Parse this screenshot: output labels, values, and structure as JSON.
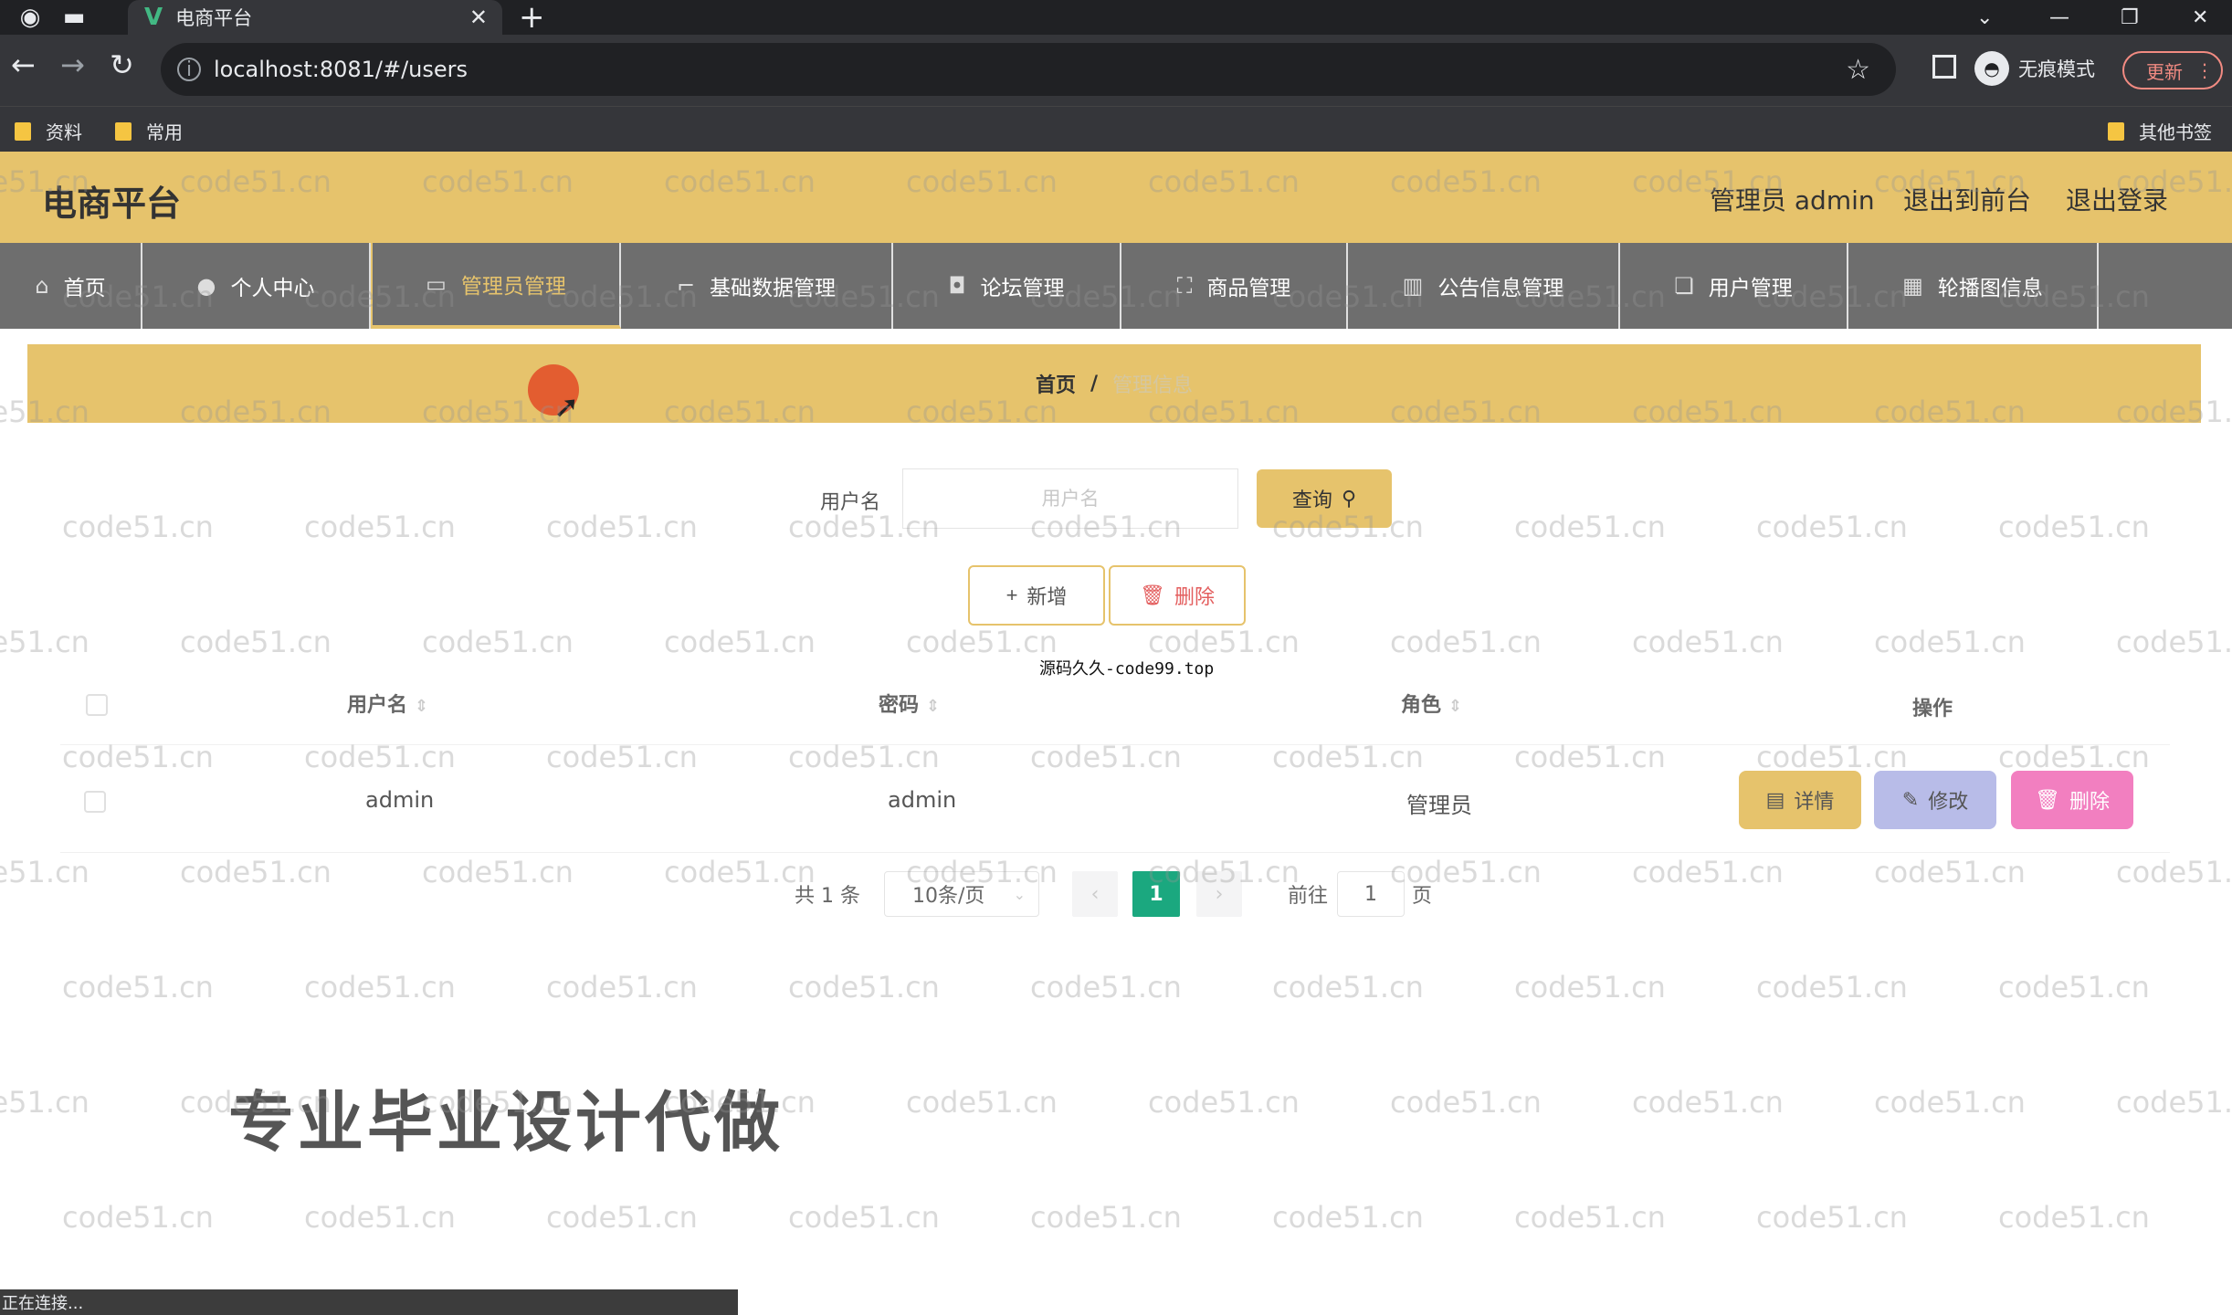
{
  "browser": {
    "tab_title": "电商平台",
    "url": "localhost:8081/#/users",
    "incognito_label": "无痕模式",
    "update_label": "更新",
    "bookmarks": [
      "资料",
      "常用"
    ],
    "other_bookmarks": "其他书签",
    "status_text": "正在连接..."
  },
  "header": {
    "brand": "电商平台",
    "user_label": "管理员 admin",
    "front_link": "退出到前台",
    "logout_link": "退出登录"
  },
  "nav": {
    "items": [
      {
        "label": "首页",
        "icon": "home-icon"
      },
      {
        "label": "个人中心",
        "icon": "user-icon"
      },
      {
        "label": "管理员管理",
        "icon": "card-icon"
      },
      {
        "label": "基础数据管理",
        "icon": "crop-icon"
      },
      {
        "label": "论坛管理",
        "icon": "mic-icon"
      },
      {
        "label": "商品管理",
        "icon": "frame-icon"
      },
      {
        "label": "公告信息管理",
        "icon": "chart-icon"
      },
      {
        "label": "用户管理",
        "icon": "copy-icon"
      },
      {
        "label": "轮播图信息",
        "icon": "grid-icon"
      }
    ],
    "active_index": 2
  },
  "breadcrumb": {
    "home": "首页",
    "separator": "/",
    "current": "管理信息"
  },
  "search": {
    "label": "用户名",
    "placeholder": "用户名",
    "query_label": "查询"
  },
  "actions": {
    "add_label": "新增",
    "delete_label": "删除"
  },
  "overlay_note": "源码久久-code99.top",
  "table": {
    "columns": [
      "用户名",
      "密码",
      "角色",
      "操作"
    ],
    "rows": [
      {
        "username": "admin",
        "password": "admin",
        "role": "管理员"
      }
    ],
    "row_actions": {
      "detail": "详情",
      "edit": "修改",
      "delete": "删除"
    }
  },
  "pagination": {
    "total": "共 1 条",
    "page_size": "10条/页",
    "current_page": "1",
    "goto_label": "前往",
    "goto_value": "1",
    "page_unit": "页"
  },
  "ad_text": "专业毕业设计代做",
  "watermark": "code51.cn",
  "colors": {
    "accent": "#e6c36c",
    "nav_bg": "#6e6e6e",
    "page_active": "#1ba87f",
    "edit_btn": "#b8bce8",
    "delete_btn": "#f27fc0"
  }
}
